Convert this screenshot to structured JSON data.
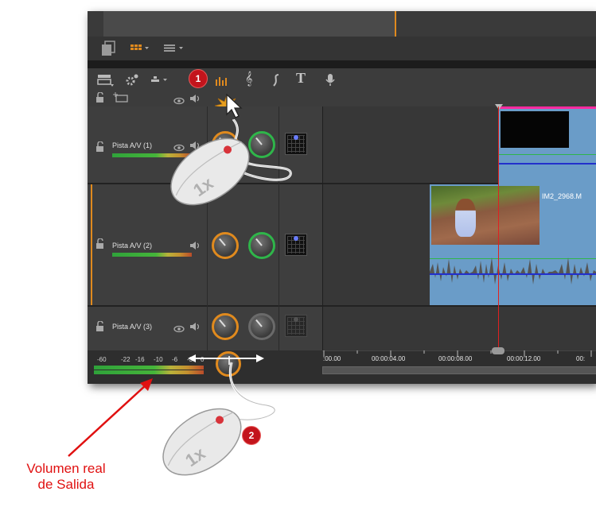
{
  "callouts": {
    "step1": "1",
    "step2": "2"
  },
  "mouse": {
    "click_label_1": "1x",
    "click_label_2": "1x"
  },
  "annotation": {
    "line1": "Volumen real",
    "line2": "de Salida"
  },
  "tracks": [
    {
      "label": "Pista A/V (1)"
    },
    {
      "label": "Pista A/V (2)"
    },
    {
      "label": "Pista A/V (3)"
    }
  ],
  "clip": {
    "title": "IM2_2968.M"
  },
  "ruler": {
    "t0": ":00.00",
    "t1": "00:00:04.00",
    "t2": "00:00:08.00",
    "t3": "00:00:12.00",
    "t4": "00:"
  },
  "output_meter": {
    "scale": [
      "-60",
      "-22",
      "-16",
      "-10",
      "-6",
      "-3",
      "0"
    ]
  },
  "icons": [
    "storyboard-icon",
    "grid-view-icon",
    "list-view-icon",
    "track-layout-icon",
    "settings-icon",
    "snap-icon",
    "audio-mixer-icon",
    "music-icon",
    "soundtrack-icon",
    "title-icon",
    "microphone-icon",
    "lock-icon",
    "add-track-icon",
    "eye-icon",
    "speaker-icon",
    "pan-icon",
    "click-burst-icon",
    "cursor-icon"
  ],
  "colors": {
    "accent_orange": "#e08a1e",
    "callout_red": "#c3141c",
    "volume_green": "#2fb54a",
    "playhead": "#e02020",
    "clip_blue": "#6a9cc8"
  }
}
